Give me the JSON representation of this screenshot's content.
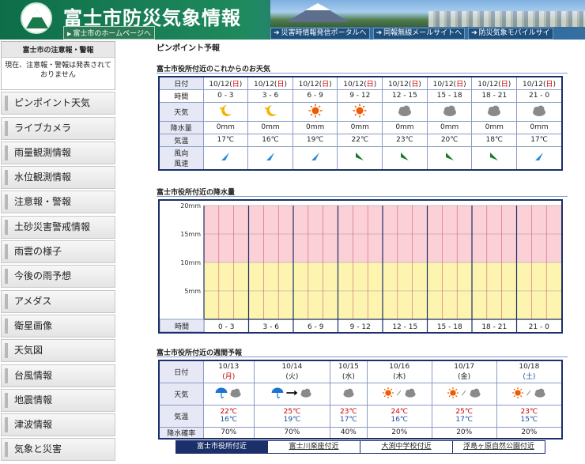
{
  "header": {
    "site_title": "富士市防災気象情報",
    "home_link": "富士市のホームページへ",
    "nav": [
      "災害時情報発信ポータルへ",
      "同報無線メールサイトへ",
      "防災気象モバイルサイ"
    ]
  },
  "sidebar": {
    "alert_title": "富士市の注意報・警報",
    "alert_body": "現在、注意報・警報は発表されておりません",
    "menu": [
      "ピンポイント天気",
      "ライブカメラ",
      "雨量観測情報",
      "水位観測情報",
      "注意報・警報",
      "土砂災害警戒情報",
      "雨雲の様子",
      "今後の雨予想",
      "アメダス",
      "衛星画像",
      "天気図",
      "台風情報",
      "地震情報",
      "津波情報",
      "気象と災害"
    ]
  },
  "main": {
    "page_title": "ピンポイント予報",
    "hourly_title": "富士市役所付近のこれからのお天気",
    "rain_title": "富士市役所付近の降水量",
    "weekly_title": "富士市役所付近の週間予報",
    "locations": [
      "富士市役所付近",
      "富士川楽座付近",
      "大渕中学校付近",
      "浮島ヶ原自然公園付近"
    ]
  },
  "hourly": {
    "labels": {
      "date": "日付",
      "time": "時間",
      "weather": "天気",
      "precip": "降水量",
      "temp": "気温",
      "wind": "風向\n風速"
    },
    "date_prefix": "10/12(",
    "date_day": "日",
    "date_suffix": ")",
    "slots": [
      {
        "time": "0 - 3",
        "weather": "moon",
        "precip": "0mm",
        "temp": "17℃",
        "wind": "wind-sw-icon",
        "wind_color": "#2a8ad4"
      },
      {
        "time": "3 - 6",
        "weather": "moon",
        "precip": "0mm",
        "temp": "16℃",
        "wind": "wind-sw-icon",
        "wind_color": "#2a8ad4"
      },
      {
        "time": "6 - 9",
        "weather": "sun",
        "precip": "0mm",
        "temp": "19℃",
        "wind": "wind-sw-icon",
        "wind_color": "#2a8ad4"
      },
      {
        "time": "9 - 12",
        "weather": "sun",
        "precip": "0mm",
        "temp": "22℃",
        "wind": "wind-se-icon",
        "wind_color": "#1a7a2a"
      },
      {
        "time": "12 - 15",
        "weather": "cloud",
        "precip": "0mm",
        "temp": "23℃",
        "wind": "wind-se-icon",
        "wind_color": "#1a7a2a"
      },
      {
        "time": "15 - 18",
        "weather": "cloud",
        "precip": "0mm",
        "temp": "20℃",
        "wind": "wind-se-icon",
        "wind_color": "#1a7a2a"
      },
      {
        "time": "18 - 21",
        "weather": "cloud",
        "precip": "0mm",
        "temp": "18℃",
        "wind": "wind-se-icon",
        "wind_color": "#1a7a2a"
      },
      {
        "time": "21 - 0",
        "weather": "cloud",
        "precip": "0mm",
        "temp": "17℃",
        "wind": "wind-sw-icon",
        "wind_color": "#2a8ad4"
      }
    ]
  },
  "chart_data": {
    "type": "bar",
    "title": "富士市役所付近の降水量",
    "xlabel": "時間",
    "ylabel": "",
    "ylim": [
      0,
      20
    ],
    "yticks": [
      "20mm",
      "15mm",
      "10mm",
      "5mm"
    ],
    "categories": [
      "0 - 3",
      "3 - 6",
      "6 - 9",
      "9 - 12",
      "12 - 15",
      "15 - 18",
      "18 - 21",
      "21 - 0"
    ],
    "values": [
      0,
      0,
      0,
      0,
      0,
      0,
      0,
      0
    ],
    "bands": [
      {
        "from": 0,
        "to": 10,
        "color": "#fdf4b0"
      },
      {
        "from": 10,
        "to": 20,
        "color": "#fbd0d6"
      }
    ]
  },
  "weekly": {
    "labels": {
      "date": "日付",
      "weather": "天気",
      "temp": "気温",
      "pop": "降水確率"
    },
    "days": [
      {
        "date": "10/13",
        "dow": "(月)",
        "dow_class": "sunday",
        "icons": [
          "umbrella",
          "cloud"
        ],
        "tmax": "22℃",
        "tmin": "16℃",
        "pop": "70%"
      },
      {
        "date": "10/14",
        "dow": "(火)",
        "dow_class": "",
        "icons": [
          "umbrella",
          "arrow",
          "cloud"
        ],
        "tmax": "25℃",
        "tmin": "19℃",
        "pop": "70%"
      },
      {
        "date": "10/15",
        "dow": "(水)",
        "dow_class": "",
        "icons": [
          "cloud"
        ],
        "tmax": "23℃",
        "tmin": "17℃",
        "pop": "40%"
      },
      {
        "date": "10/16",
        "dow": "(木)",
        "dow_class": "",
        "icons": [
          "sun",
          "slash",
          "cloud"
        ],
        "tmax": "24℃",
        "tmin": "16℃",
        "pop": "20%"
      },
      {
        "date": "10/17",
        "dow": "(金)",
        "dow_class": "",
        "icons": [
          "sun",
          "slash",
          "cloud"
        ],
        "tmax": "25℃",
        "tmin": "17℃",
        "pop": "20%"
      },
      {
        "date": "10/18",
        "dow": "(土)",
        "dow_class": "sat",
        "icons": [
          "sun",
          "slash",
          "cloud"
        ],
        "tmax": "23℃",
        "tmin": "15℃",
        "pop": "20%"
      }
    ]
  }
}
